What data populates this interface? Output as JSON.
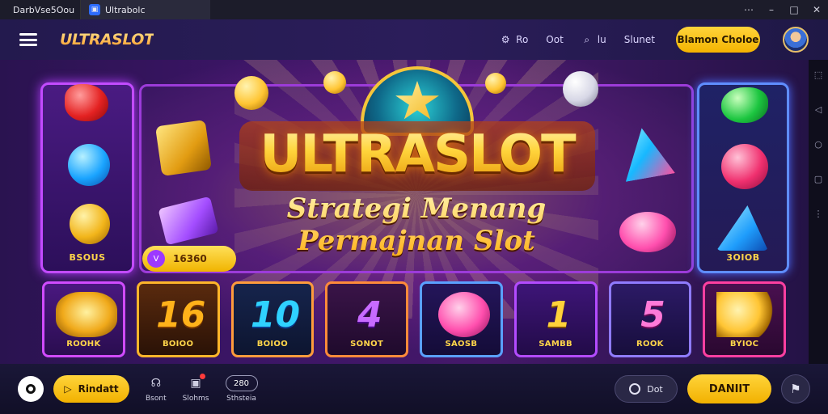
{
  "browser": {
    "tabs": [
      {
        "label": "DarbVse5Oou"
      },
      {
        "label": "Ultrabolc"
      }
    ],
    "controls": {
      "more": "⋯",
      "minimize": "–",
      "maximize": "□",
      "close": "✕"
    }
  },
  "nav": {
    "brand": "ULTRASLOT",
    "links": [
      {
        "label": "Ro",
        "icon": "gear-icon"
      },
      {
        "label": "Oot",
        "icon": ""
      },
      {
        "label": "lu",
        "icon": "search-icon"
      },
      {
        "label": "Slunet",
        "icon": ""
      }
    ],
    "cta_label": "Blamon Choloe"
  },
  "hero": {
    "title": "ULTRASLOT",
    "subtitle_line1": "Strategi Menang",
    "subtitle_line2": "Permajnan Slot",
    "left_panel_label": "BSOUS",
    "right_panel_label": "3OIOB",
    "balance_icon": "V",
    "balance_value": "16360"
  },
  "tiles": [
    {
      "caption": "ROOHK",
      "art": ""
    },
    {
      "caption": "BOIOO",
      "art": "16"
    },
    {
      "caption": "BOIOO",
      "art": "10"
    },
    {
      "caption": "SONOT",
      "art": "4"
    },
    {
      "caption": "SAOSB",
      "art": ""
    },
    {
      "caption": "SAMBB",
      "art": "1"
    },
    {
      "caption": "ROOK",
      "art": "5"
    },
    {
      "caption": "BYIOC",
      "art": ""
    }
  ],
  "sidestrip": {
    "icons": [
      "⬚",
      "◁",
      "○",
      "▢",
      "⋮"
    ]
  },
  "bottom": {
    "primary_label": "Rindatt",
    "items": [
      {
        "label": "Bsont",
        "icon": "headset-icon"
      },
      {
        "label": "Slohms",
        "icon": "gift-icon"
      },
      {
        "label": "Sthsteia",
        "pill": "280"
      }
    ],
    "outline_label": "Dot",
    "main_label": "DANIIT",
    "round_icon": "flag-icon"
  },
  "colors": {
    "accent": "#ffd43b",
    "nav_bg": "#2b1d5a",
    "stage_bg": "#3b1565"
  }
}
